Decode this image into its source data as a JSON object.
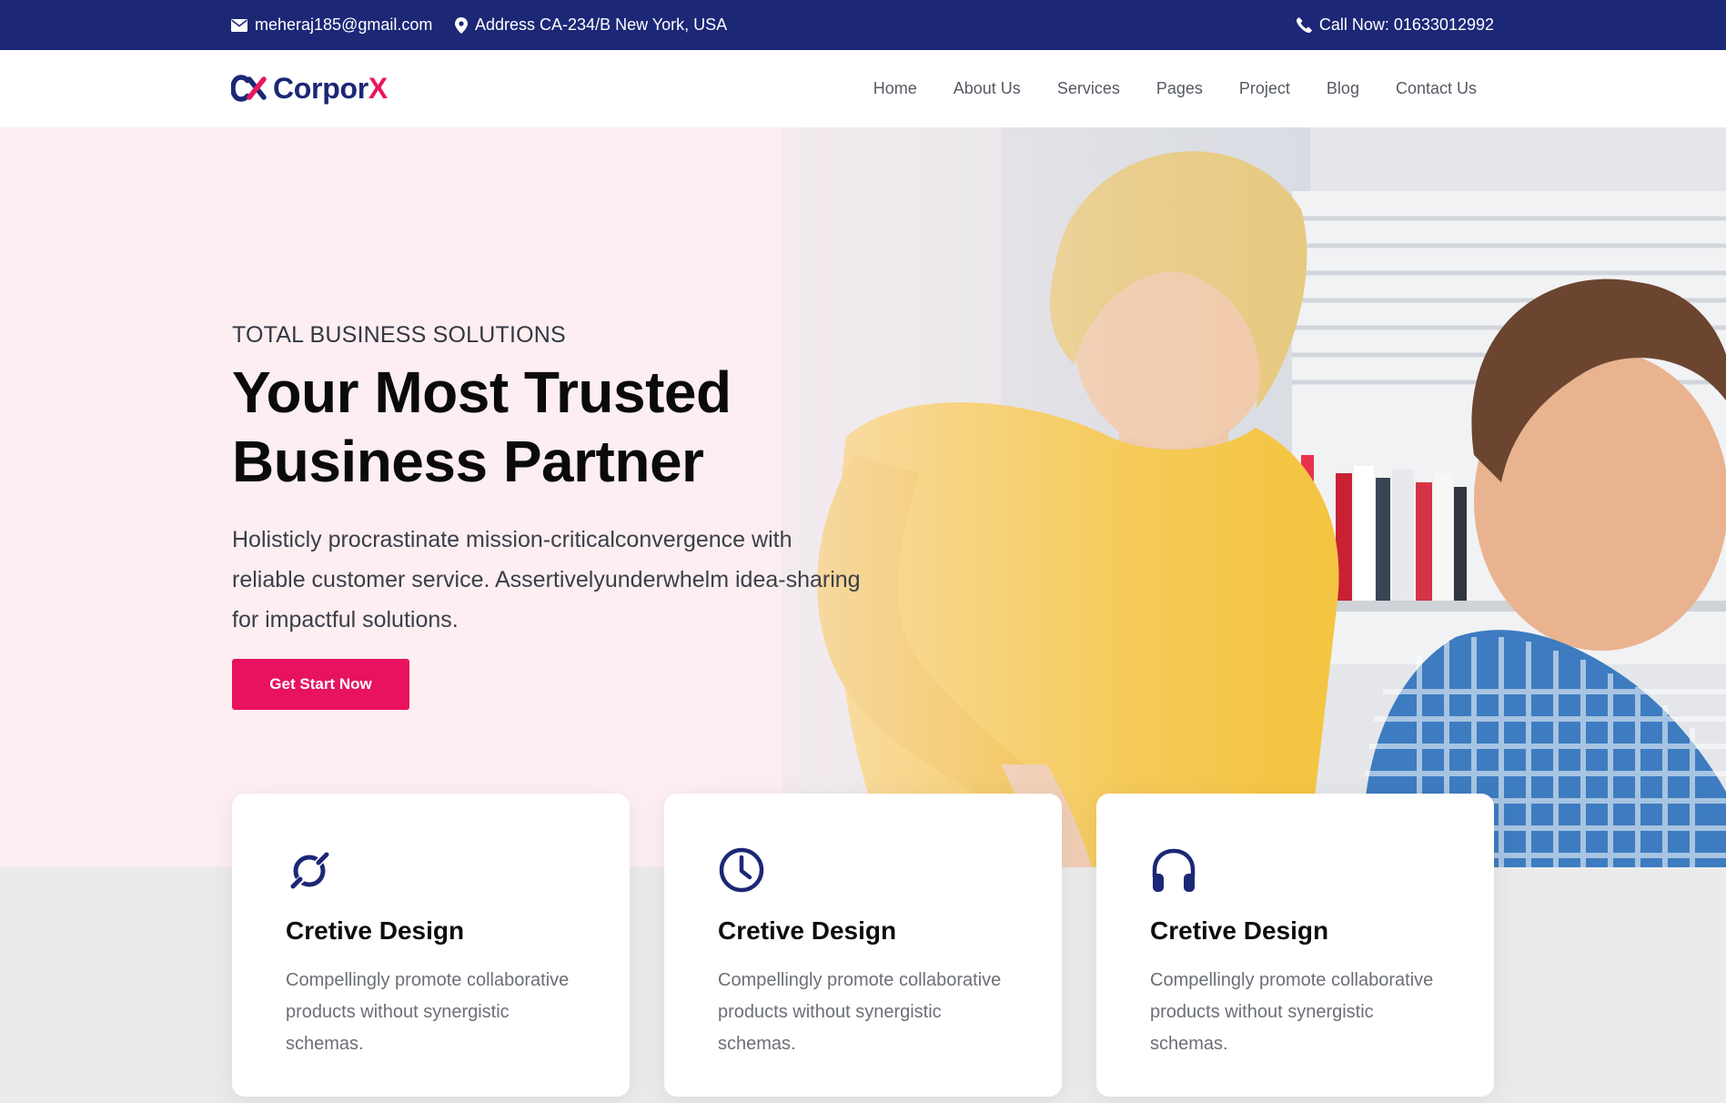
{
  "topbar": {
    "email": "meheraj185@gmail.com",
    "address": "Address CA-234/B New York, USA",
    "phone": "Call Now: 01633012992",
    "icons": [
      "envelope-icon",
      "map-marker-icon",
      "phone-icon"
    ]
  },
  "logo": {
    "mark": "CX",
    "name_main": "Corpor",
    "name_accent": "X"
  },
  "nav": {
    "items": [
      "Home",
      "About Us",
      "Services",
      "Pages",
      "Project",
      "Blog",
      "Contact Us"
    ]
  },
  "hero": {
    "kicker": "TOTAL BUSINESS SOLUTIONS",
    "title_line1": "Your Most Trusted",
    "title_line2": "Business Partner",
    "description": "Holisticly procrastinate mission-criticalconvergence with reliable customer service. Assertivelyunderwhelm idea-sharing for impactful solutions.",
    "button": "Get Start Now"
  },
  "features": [
    {
      "icon": "orbit-icon",
      "title": "Cretive Design",
      "text": "Compellingly promote collaborative products without synergistic schemas."
    },
    {
      "icon": "clock-icon",
      "title": "Cretive Design",
      "text": "Compellingly promote collaborative products without synergistic schemas."
    },
    {
      "icon": "headphones-icon",
      "title": "Cretive Design",
      "text": "Compellingly promote collaborative products without synergistic schemas."
    }
  ],
  "colors": {
    "topbar": "#1c2776",
    "brand_navy": "#1c2776",
    "accent_pink": "#e8125f",
    "hero_bg": "#fbeef0",
    "section_bg": "#ebebeb"
  }
}
